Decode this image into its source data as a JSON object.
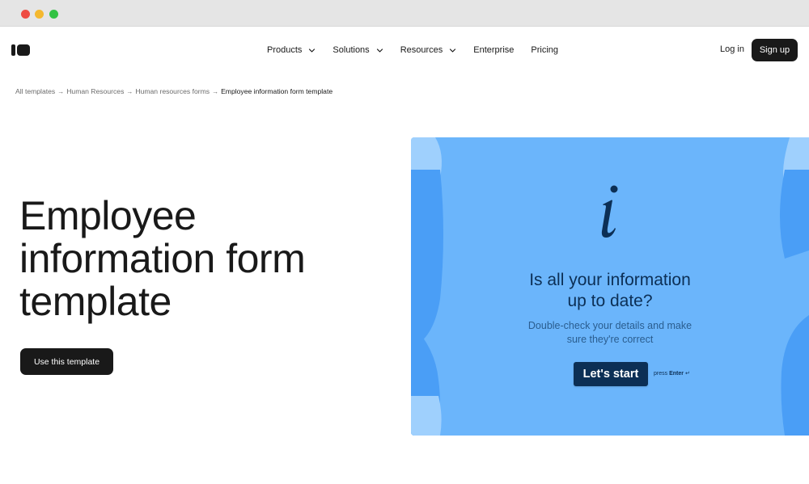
{
  "nav": {
    "menu": [
      {
        "label": "Products",
        "dropdown": true
      },
      {
        "label": "Solutions",
        "dropdown": true
      },
      {
        "label": "Resources",
        "dropdown": true
      },
      {
        "label": "Enterprise",
        "dropdown": false
      },
      {
        "label": "Pricing",
        "dropdown": false
      }
    ],
    "login_label": "Log in",
    "signup_label": "Sign up"
  },
  "breadcrumb": {
    "items": [
      "All templates",
      "Human Resources",
      "Human resources forms",
      "Employee information form template"
    ],
    "separator": "→"
  },
  "hero": {
    "title_lines": [
      "Employee",
      "information form",
      "template"
    ],
    "cta_label": "Use this template"
  },
  "preview": {
    "glyph": "i",
    "title_lines": [
      "Is all your information",
      "up to date?"
    ],
    "subtitle_lines": [
      "Double-check your details and make",
      "sure they're correct"
    ],
    "start_label": "Let's start",
    "press_prefix": "press",
    "press_key": "Enter",
    "enter_symbol": "↵",
    "colors": {
      "background": "#6bb5fb",
      "accent": "#0c2f55",
      "shape_light": "#9fd0fd",
      "shape_mid": "#4a9ef6"
    }
  },
  "colors": {
    "primary": "#191919",
    "chrome": "#e5e5e5"
  }
}
